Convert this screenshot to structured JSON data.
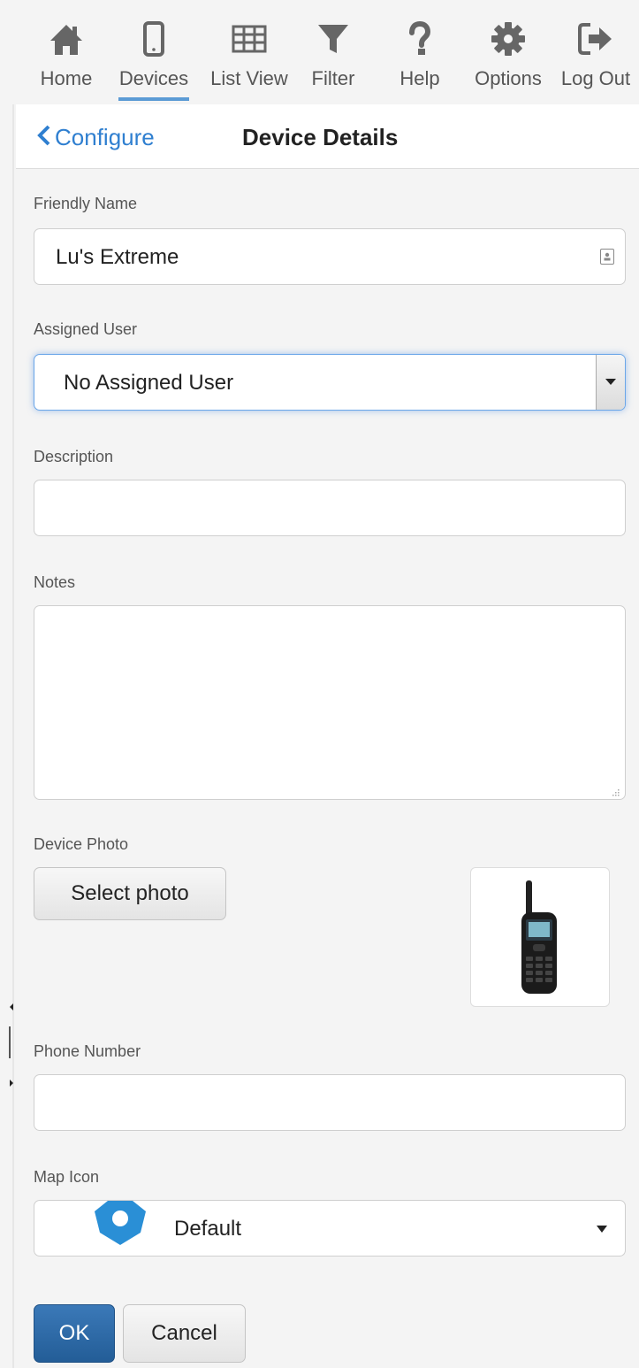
{
  "toolbar": {
    "items": [
      {
        "label": "Home",
        "icon": "home-icon"
      },
      {
        "label": "Devices",
        "icon": "phone-icon",
        "active": true
      },
      {
        "label": "List View",
        "icon": "grid-icon"
      },
      {
        "label": "Filter",
        "icon": "filter-icon"
      },
      {
        "label": "Help",
        "icon": "question-icon"
      },
      {
        "label": "Options",
        "icon": "gear-icon"
      },
      {
        "label": "Log Out",
        "icon": "logout-icon"
      }
    ]
  },
  "header": {
    "back_label": "Configure",
    "title": "Device Details"
  },
  "form": {
    "friendly_name": {
      "label": "Friendly Name",
      "value": "Lu's Extreme"
    },
    "assigned_user": {
      "label": "Assigned User",
      "value": "No Assigned User"
    },
    "description": {
      "label": "Description",
      "value": ""
    },
    "notes": {
      "label": "Notes",
      "value": ""
    },
    "device_photo": {
      "label": "Device Photo",
      "button": "Select photo",
      "image": "satellite-phone-image"
    },
    "phone_number": {
      "label": "Phone Number",
      "value": ""
    },
    "map_icon": {
      "label": "Map Icon",
      "value": "Default",
      "icon": "map-marker-icon"
    }
  },
  "actions": {
    "ok": "OK",
    "cancel": "Cancel"
  },
  "colors": {
    "accent": "#2f7fd0",
    "primary_button": "#2a6aa8",
    "active_underline": "#5b9bd5",
    "map_marker": "#2a8fd6"
  }
}
